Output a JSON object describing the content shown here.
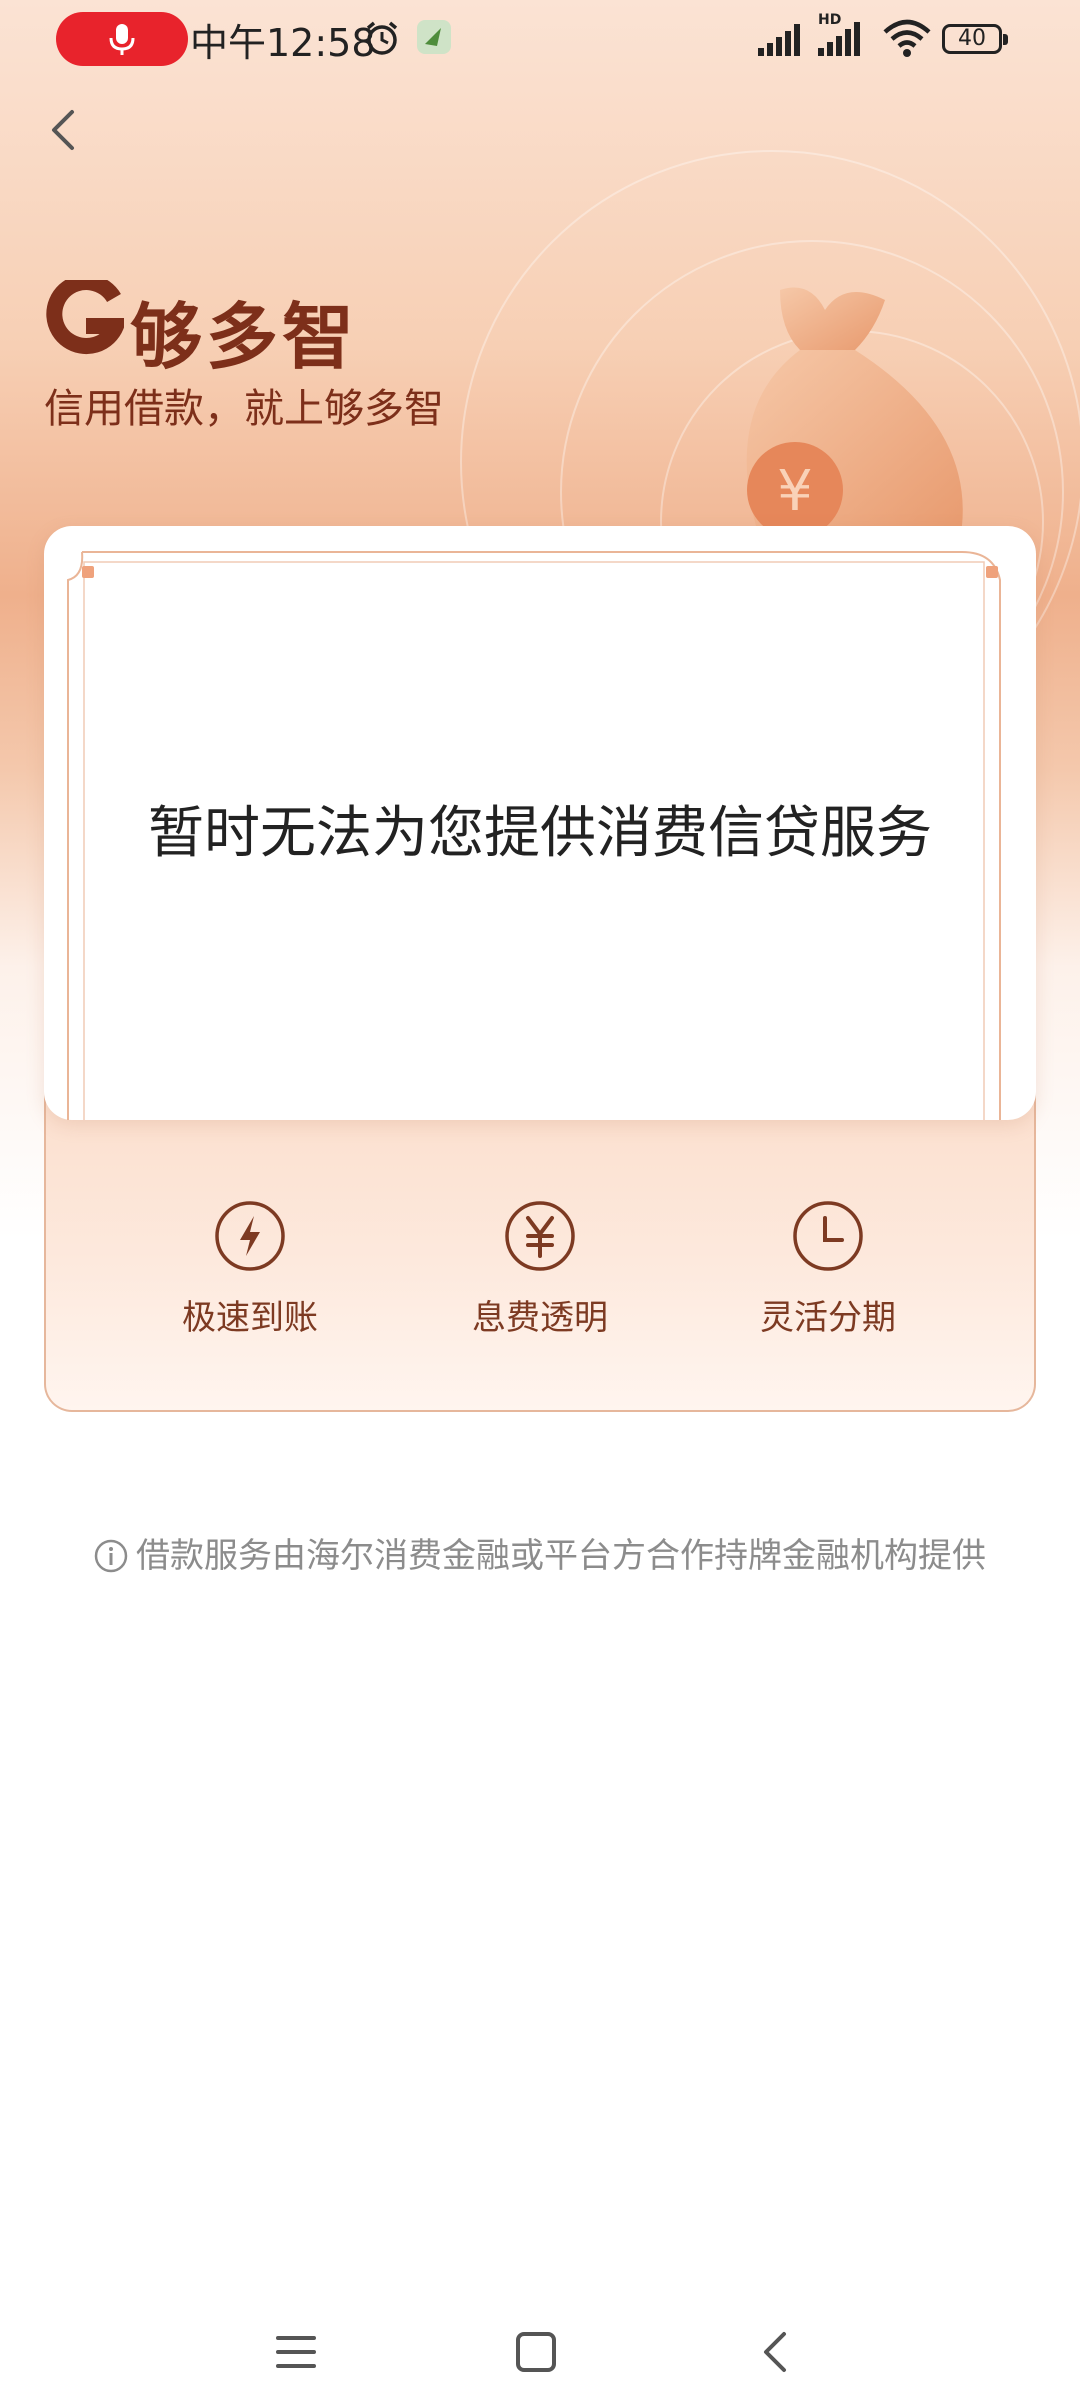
{
  "status_bar": {
    "time": "中午12:58",
    "battery": "40",
    "network_label": "HD"
  },
  "brand": {
    "name": "够多智",
    "slogan": "信用借款，就上够多智"
  },
  "card": {
    "message": "暂时无法为您提供消费信贷服务"
  },
  "features": [
    {
      "label": "极速到账",
      "icon": "lightning-icon"
    },
    {
      "label": "息费透明",
      "icon": "yuan-icon"
    },
    {
      "label": "灵活分期",
      "icon": "clock-icon"
    }
  ],
  "disclaimer": "借款服务由海尔消费金融或平台方合作持牌金融机构提供",
  "colors": {
    "brand_brown": "#7d2f1a",
    "mic_red": "#e8232c",
    "accent_orange": "#efb08c"
  }
}
